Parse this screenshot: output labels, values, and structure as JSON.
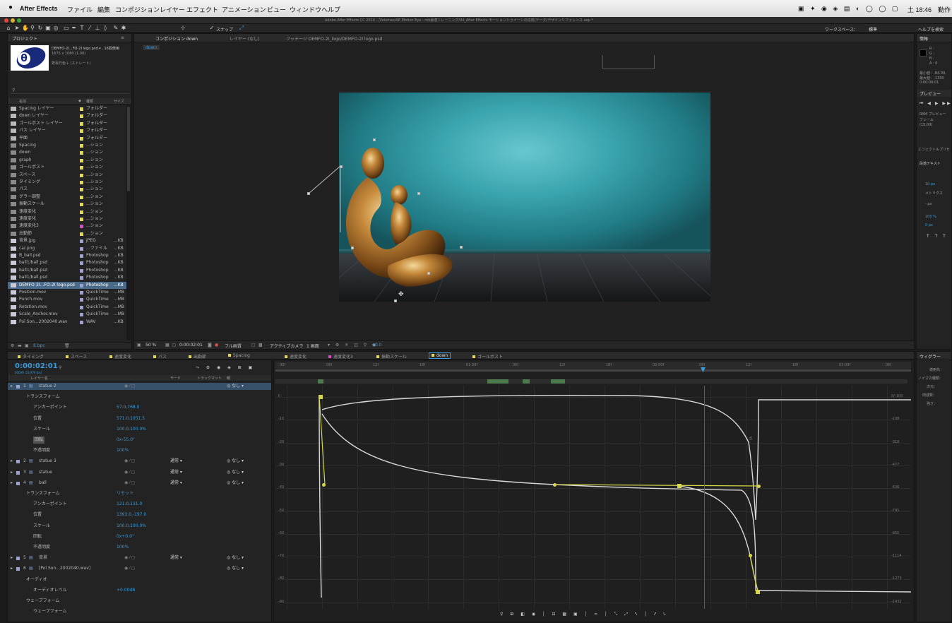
{
  "menubar": {
    "apple": "",
    "app": "After Effects",
    "items": [
      "ファイル",
      "編集",
      "コンポジション",
      "レイヤー",
      "エフェクト",
      "アニメーション",
      "ビュー",
      "ウィンドウ",
      "ヘルプ"
    ],
    "clock": "土 18:46",
    "right_label": "勤作"
  },
  "window_title": "Adobe After Effects CC 2014 - /Volumes/AE Motion Eye - mb最適トレーニング/04_After Effects モーショントゥイーンの応用/データ/デザインリファレンス.aep *",
  "toolbar": {
    "snap_label": "スナップ",
    "workspace_label": "ワークスペース：",
    "workspace_value": "標準",
    "help_search": "ヘルプを検索"
  },
  "project": {
    "tab": "プロジェクト",
    "selected_name": "DEMFO-2I...FO-2I logo.psd ▾ , 16回使用",
    "selected_dims": "1675 x 1080 (1.00)",
    "selected_color": "数百万色＋ (ストレート)",
    "search_placeholder": "",
    "col_name": "名前",
    "col_type": "種類",
    "col_size": "サイズ",
    "items": [
      {
        "name": "Spacing レイヤー",
        "type": "フォルダー",
        "size": "",
        "color": "#e6d84a",
        "kind": "folder"
      },
      {
        "name": "down レイヤー",
        "type": "フォルダー",
        "size": "",
        "color": "#e6d84a",
        "kind": "folder"
      },
      {
        "name": "ゴールボスト レイヤー",
        "type": "フォルダー",
        "size": "",
        "color": "#e6d84a",
        "kind": "folder"
      },
      {
        "name": "パス レイヤー",
        "type": "フォルダー",
        "size": "",
        "color": "#e6d84a",
        "kind": "folder"
      },
      {
        "name": "平面",
        "type": "フォルダー",
        "size": "",
        "color": "#e6d84a",
        "kind": "folder"
      },
      {
        "name": "Spacing",
        "type": "...ション",
        "size": "",
        "color": "#e6d84a",
        "kind": "comp"
      },
      {
        "name": "down",
        "type": "...ション",
        "size": "",
        "color": "#e6d84a",
        "kind": "comp"
      },
      {
        "name": "graph",
        "type": "...ション",
        "size": "",
        "color": "#e6d84a",
        "kind": "comp"
      },
      {
        "name": "ゴールボスト",
        "type": "...ション",
        "size": "",
        "color": "#e6d84a",
        "kind": "comp"
      },
      {
        "name": "スペース",
        "type": "...ション",
        "size": "",
        "color": "#e6d84a",
        "kind": "comp"
      },
      {
        "name": "タイミング",
        "type": "...ション",
        "size": "",
        "color": "#e6d84a",
        "kind": "comp"
      },
      {
        "name": "パス",
        "type": "...ション",
        "size": "",
        "color": "#e6d84a",
        "kind": "comp"
      },
      {
        "name": "グラー調整",
        "type": "...ション",
        "size": "",
        "color": "#e6d84a",
        "kind": "comp"
      },
      {
        "name": "振動スケール",
        "type": "...ション",
        "size": "",
        "color": "#e6d84a",
        "kind": "comp"
      },
      {
        "name": "速度変化",
        "type": "...ション",
        "size": "",
        "color": "#e6d84a",
        "kind": "comp"
      },
      {
        "name": "速度変化",
        "type": "...ション",
        "size": "",
        "color": "#e6d84a",
        "kind": "comp"
      },
      {
        "name": "速度変化3",
        "type": "...ション",
        "size": "",
        "color": "#d94ac9",
        "kind": "comp"
      },
      {
        "name": "出勤節",
        "type": "...ション",
        "size": "",
        "color": "#e6d84a",
        "kind": "comp"
      },
      {
        "name": "背景.jpg",
        "type": "JPEG",
        "size": "...KB",
        "color": "#9aa0d8",
        "kind": "file"
      },
      {
        "name": "car.png",
        "type": "...ファイル",
        "size": "...KB",
        "color": "#9aa0d8",
        "kind": "file"
      },
      {
        "name": "B_ball.psd",
        "type": "Photoshop",
        "size": "...KB",
        "color": "#9aa0d8",
        "kind": "file"
      },
      {
        "name": "ball1/ball.psd",
        "type": "Photoshop",
        "size": "...KB",
        "color": "#9aa0d8",
        "kind": "file"
      },
      {
        "name": "ball1/ball.psd",
        "type": "Photoshop",
        "size": "...KB",
        "color": "#9aa0d8",
        "kind": "file"
      },
      {
        "name": "ball1/ball.psd",
        "type": "Photoshop",
        "size": "...KB",
        "color": "#9aa0d8",
        "kind": "file"
      },
      {
        "name": "DEMFO-2I...FO-2I logo.psd",
        "type": "Photoshop",
        "size": "...KB",
        "color": "#9aa0d8",
        "kind": "file",
        "selected": true
      },
      {
        "name": "Position.mov",
        "type": "QuickTime",
        "size": "...MB",
        "color": "#9aa0d8",
        "kind": "file"
      },
      {
        "name": "Punch.mov",
        "type": "QuickTime",
        "size": "...MB",
        "color": "#9aa0d8",
        "kind": "file"
      },
      {
        "name": "Rotation.mov",
        "type": "QuickTime",
        "size": "...MB",
        "color": "#9aa0d8",
        "kind": "file"
      },
      {
        "name": "Scale_Anchor.mov",
        "type": "QuickTime",
        "size": "...MB",
        "color": "#9aa0d8",
        "kind": "file"
      },
      {
        "name": "Pol Son...2002040.wav",
        "type": "WAV",
        "size": "...KB",
        "color": "#9aa0d8",
        "kind": "file"
      }
    ],
    "footer_bpc": "8 bpc"
  },
  "composition": {
    "tabs": [
      "コンポジション down",
      "レイヤー (なし)",
      "フッテージ DEMFO-2I_logo/DEMFO-2I logo.psd"
    ],
    "breadcrumb": "down",
    "zoom": "50 %",
    "timecode": "0:00:02:01",
    "quality": "フル画質",
    "camera": "アクティブカメラ",
    "views": "1 画面",
    "exposure": "+0.0"
  },
  "info_panel": {
    "tab": "情報",
    "r": "R :",
    "g": "G :",
    "b": "B :",
    "a": "A : 0",
    "x_line": "最小値：-84.00,",
    "y_line": "最大値：-1330",
    "t_line": "0:00:00:01",
    "preview_tab": "プレビュー",
    "ram_preview": "RAM プレビュー",
    "frame_label": "フレーム",
    "rate": "(15.00)",
    "effects_tab": "エフェクト＆プリセ",
    "character_tab": "段落テキスト",
    "font_size": "10 px",
    "tracking": "メトリクス",
    "leading": "- px",
    "scale_h": "100 %",
    "scale_v": "0 px"
  },
  "timeline": {
    "tabs": [
      "タイミング",
      "スペース",
      "速度変化",
      "パス",
      "出勤節",
      "Spacing",
      "速度変化",
      "速度変化3",
      "振動スケール",
      "down",
      "ゴールボスト"
    ],
    "active_tab": "down",
    "timecode": "0:00:02:01",
    "fps_info": "00049 (23.976 fps)",
    "col_layer_name": "レイヤー名",
    "col_mode": "モード",
    "col_trkmat": "トラックマット",
    "col_parent": "親",
    "layers": [
      {
        "label": "1",
        "name": "statue 2",
        "selected": true,
        "parent": "なし"
      },
      {
        "label": "",
        "name": "トランスフォーム",
        "indent": 1
      },
      {
        "label": "",
        "name": "アンカーポイント",
        "indent": 2,
        "value": "57.0,768.0"
      },
      {
        "label": "",
        "name": "位置",
        "indent": 2,
        "value": "571.0,1051.5"
      },
      {
        "label": "",
        "name": "スケール",
        "indent": 2,
        "value": "100.0,100.0%"
      },
      {
        "label": "",
        "name": "回転",
        "indent": 2,
        "value": "0x-55.0°",
        "highlight": true
      },
      {
        "label": "",
        "name": "不透明度",
        "indent": 2,
        "value": "100%"
      },
      {
        "label": "2",
        "name": "statue 3",
        "mode": "通常",
        "parent": "なし"
      },
      {
        "label": "3",
        "name": "statue",
        "mode": "通常",
        "parent": "なし"
      },
      {
        "label": "4",
        "name": "ball",
        "mode": "通常",
        "parent": "なし"
      },
      {
        "label": "",
        "name": "トランスフォーム",
        "indent": 1,
        "value": "リセット"
      },
      {
        "label": "",
        "name": "アンカーポイント",
        "indent": 2,
        "value": "121.0,131.0"
      },
      {
        "label": "",
        "name": "位置",
        "indent": 2,
        "value": "1393.0,-197.0"
      },
      {
        "label": "",
        "name": "スケール",
        "indent": 2,
        "value": "100.0,100.0%"
      },
      {
        "label": "",
        "name": "回転",
        "indent": 2,
        "value": "0x+0.0°"
      },
      {
        "label": "",
        "name": "不透明度",
        "indent": 2,
        "value": "100%"
      },
      {
        "label": "5",
        "name": "背景",
        "mode": "通常",
        "parent": "なし"
      },
      {
        "label": "6",
        "name": "[Pol Son...2002040.wav]",
        "parent": "なし"
      },
      {
        "label": "",
        "name": "オーディオ",
        "indent": 1
      },
      {
        "label": "",
        "name": "オーディオレベル",
        "indent": 2,
        "value": "+0.00dB"
      },
      {
        "label": "",
        "name": "ウェーブフォーム",
        "indent": 1
      },
      {
        "label": "",
        "name": "ウェーブフォーム",
        "indent": 2
      }
    ],
    "ruler_labels": [
      "00f",
      "06f",
      "12f",
      "18f",
      "01:00f",
      "06f",
      "12f",
      "18f",
      "02:00f",
      "06f",
      "12f",
      "18f",
      "03:00f",
      "06f"
    ],
    "left_axis": [
      "0",
      "-10",
      "-20",
      "-30",
      "-40",
      "-50",
      "-60",
      "-70",
      "-80",
      "-90"
    ],
    "right_axis": [
      "0/-100",
      "-108",
      "-318",
      "-477",
      "-636",
      "-795",
      "-955",
      "-1114",
      "-1273",
      "-1432"
    ]
  },
  "wiggler": {
    "tab": "ウィグラー",
    "apply_to": "適用先：",
    "noise": "ノイズの種類：",
    "dims": "次元：",
    "freq": "周波数：",
    "magnitude": "強さ："
  },
  "colors": {
    "accent_blue": "#3b9ad9",
    "keyframe_yellow": "#d6d64a",
    "playhead_red": "#d02a2a",
    "teal_bg": "#2a8c96"
  }
}
